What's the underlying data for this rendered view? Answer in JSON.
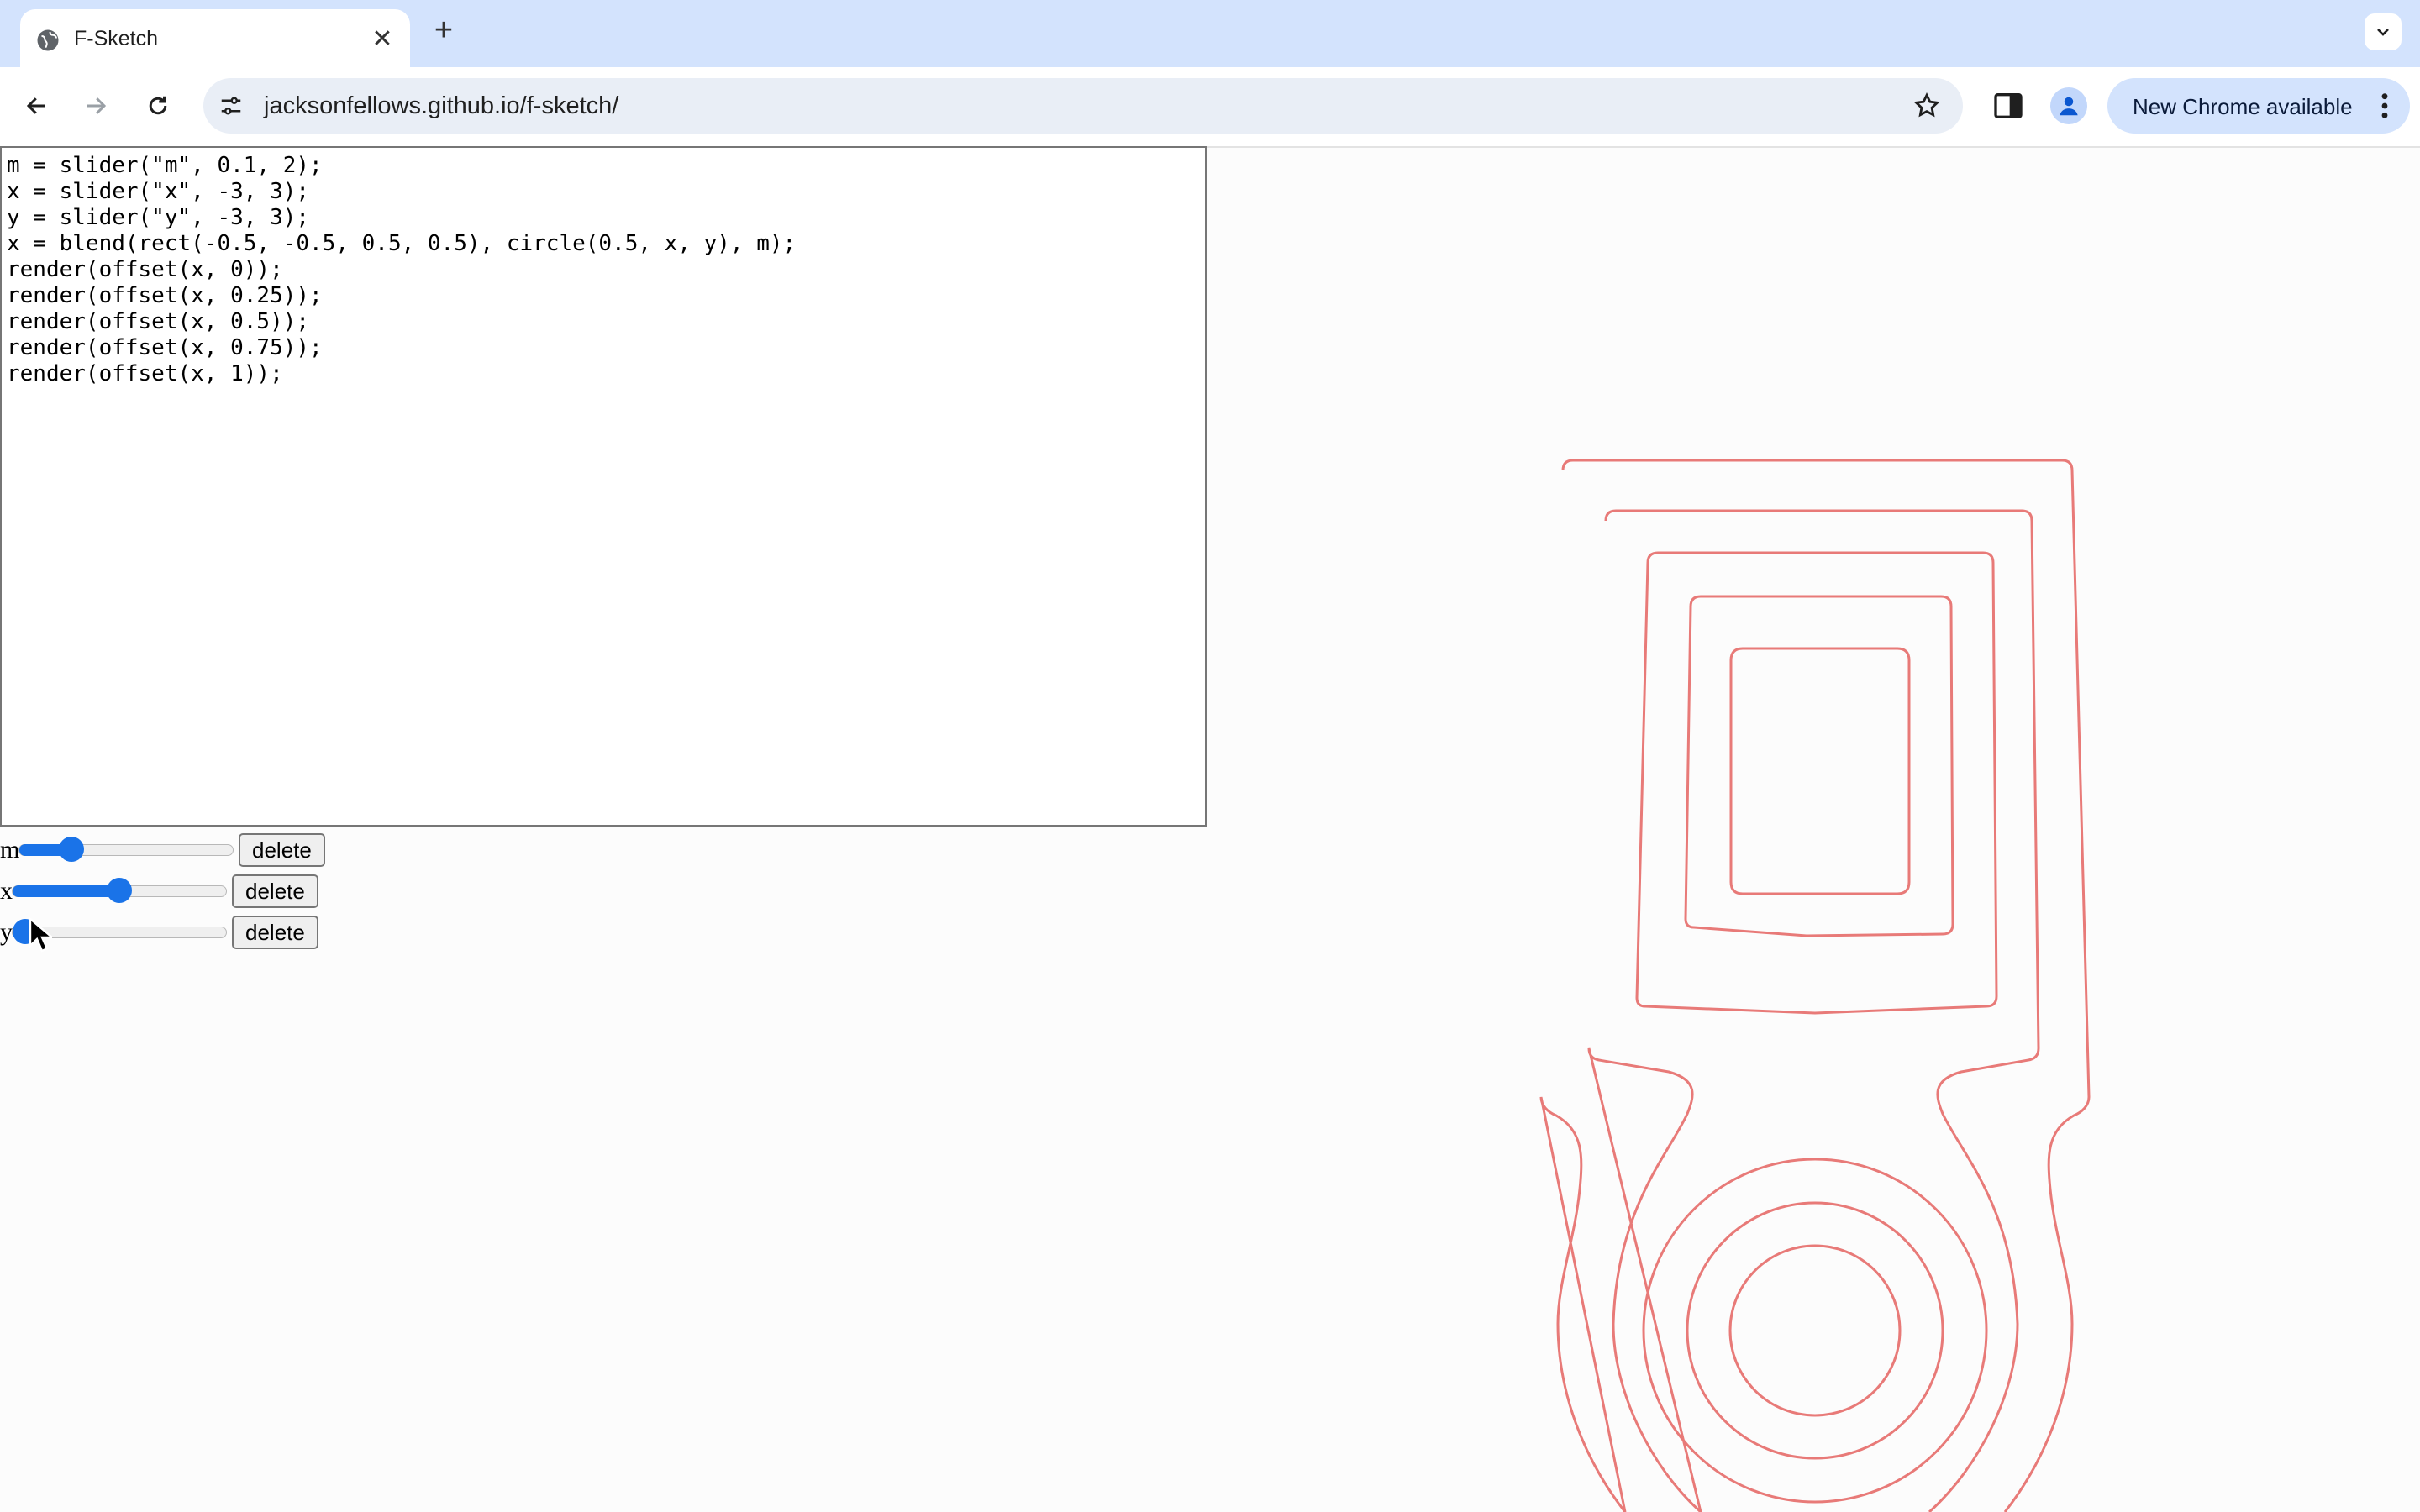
{
  "browser": {
    "tab_title": "F-Sketch",
    "url": "jacksonfellows.github.io/f-sketch/",
    "update_label": "New Chrome available",
    "icons": [
      "globe-icon",
      "close-icon",
      "plus-icon",
      "chevron-down-icon",
      "back-icon",
      "forward-icon",
      "reload-icon",
      "site-settings-icon",
      "bookmark-star-icon",
      "side-panel-icon",
      "profile-icon",
      "more-vert-icon"
    ]
  },
  "editor": {
    "code": "m = slider(\"m\", 0.1, 2);\nx = slider(\"x\", -3, 3);\ny = slider(\"y\", -3, 3);\nx = blend(rect(-0.5, -0.5, 0.5, 0.5), circle(0.5, x, y), m);\nrender(offset(x, 0));\nrender(offset(x, 0.25));\nrender(offset(x, 0.5));\nrender(offset(x, 0.75));\nrender(offset(x, 1));"
  },
  "sliders": [
    {
      "label": "m",
      "min": 0.1,
      "max": 2,
      "value": 0.5,
      "delete_label": "delete"
    },
    {
      "label": "x",
      "min": -3,
      "max": 3,
      "value": 0,
      "delete_label": "delete"
    },
    {
      "label": "y",
      "min": -3,
      "max": 3,
      "value": -3,
      "delete_label": "delete"
    }
  ],
  "render": {
    "stroke_color": "#e87a78",
    "offsets": [
      0,
      0.25,
      0.5,
      0.75,
      1
    ]
  },
  "colors": {
    "tabbar": "#d3e3fd",
    "accent": "#1a73e8"
  }
}
